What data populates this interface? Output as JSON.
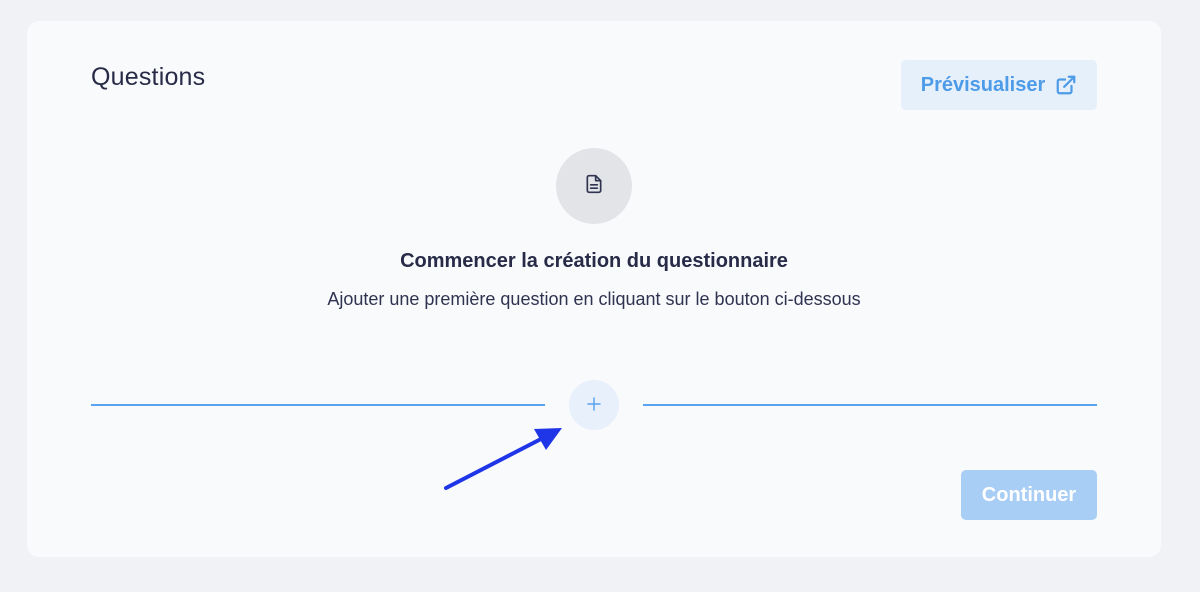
{
  "section": {
    "title": "Questions"
  },
  "toolbar": {
    "preview_label": "Prévisualiser",
    "preview_icon": "external-link-icon",
    "accent_color": "#4e9be8"
  },
  "empty_state": {
    "icon": "document-icon",
    "title": "Commencer la création du questionnaire",
    "subtitle": "Ajouter une première question en cliquant sur le bouton ci-dessous"
  },
  "add_question": {
    "icon": "plus-icon"
  },
  "footer": {
    "continue_label": "Continuer",
    "continue_disabled": true
  },
  "annotation": {
    "icon": "arrow-icon",
    "color": "#1f35e8"
  }
}
